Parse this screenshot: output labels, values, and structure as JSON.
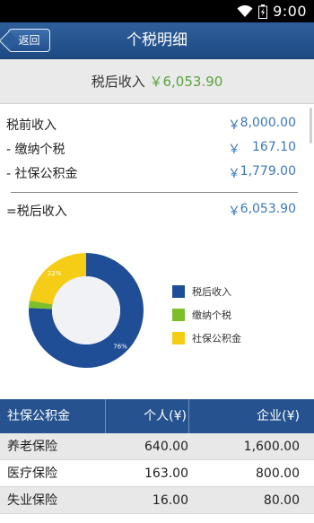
{
  "status_bar": {
    "time": "9:00"
  },
  "header": {
    "back_label": "返回",
    "title": "个税明细"
  },
  "summary": {
    "label": "税后收入",
    "value": "￥6,053.90"
  },
  "breakdown": [
    {
      "label": "税前收入",
      "currency": "￥",
      "amount": "8,000.00"
    },
    {
      "label": "- 缴纳个税",
      "currency": "￥",
      "amount": "167.10"
    },
    {
      "label": "- 社保公积金",
      "currency": "￥",
      "amount": "1,779.00"
    }
  ],
  "result": {
    "label": "=税后收入",
    "currency": "￥",
    "amount": "6,053.90"
  },
  "chart_data": {
    "type": "pie",
    "categories": [
      "税后收入",
      "缴纳个税",
      "社保公积金"
    ],
    "values": [
      6053.9,
      167.1,
      1779.0
    ],
    "colors": [
      "#1f4e96",
      "#7cbf2a",
      "#f5cc16"
    ],
    "data_labels": [
      "76%",
      "",
      "22%"
    ],
    "legend_position": "right"
  },
  "table": {
    "headers": [
      "社保公积金",
      "个人(¥)",
      "企业(¥)"
    ],
    "rows": [
      [
        "养老保险",
        "640.00",
        "1,600.00"
      ],
      [
        "医疗保险",
        "163.00",
        "800.00"
      ],
      [
        "失业保险",
        "16.00",
        "80.00"
      ]
    ]
  }
}
